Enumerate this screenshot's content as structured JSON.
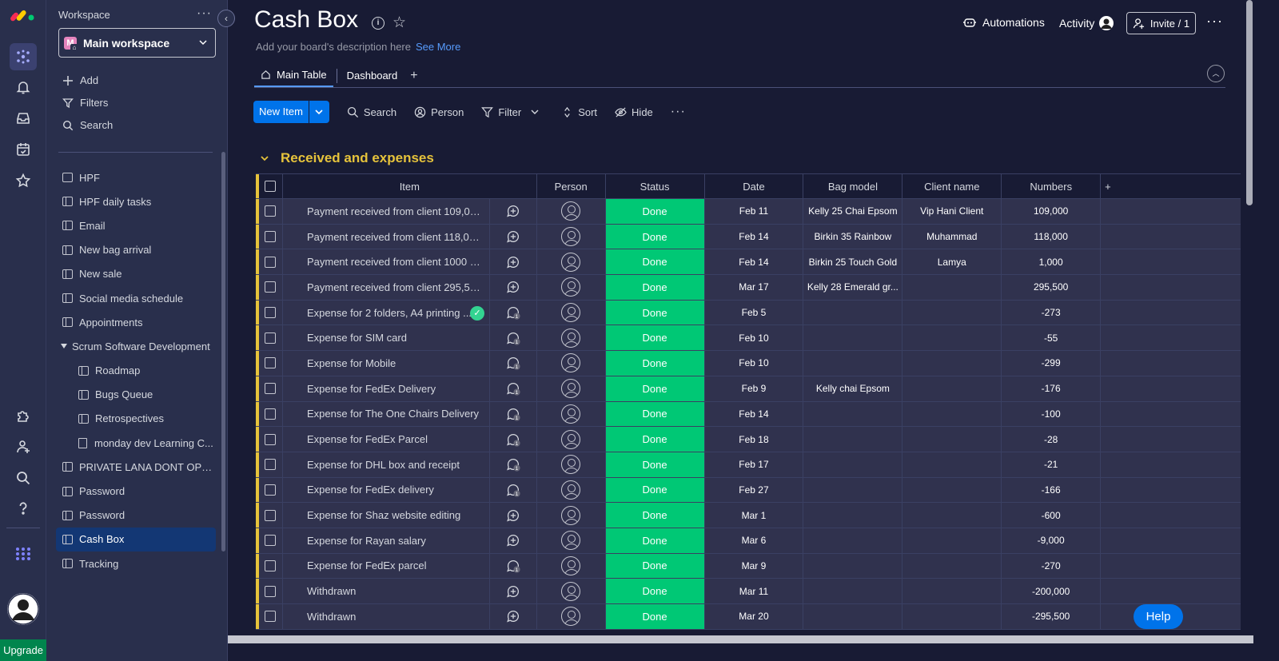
{
  "rail": {
    "items": [
      "home-icon",
      "notifications-icon",
      "inbox-icon",
      "my-work-icon",
      "favorites-icon",
      "apps-icon",
      "invite-members-icon",
      "search-icon",
      "help-icon",
      "product-switcher-icon"
    ],
    "upgrade_label": "Upgrade"
  },
  "sidebar": {
    "workspace_label": "Workspace",
    "workspace_badge": "M",
    "workspace_name": "Main workspace",
    "actions": {
      "add": "Add",
      "filters": "Filters",
      "search": "Search"
    },
    "items": [
      {
        "label": "HPF",
        "type": "dashboard"
      },
      {
        "label": "HPF daily tasks",
        "type": "board"
      },
      {
        "label": "Email",
        "type": "board"
      },
      {
        "label": "New bag arrival",
        "type": "board"
      },
      {
        "label": "New sale",
        "type": "board"
      },
      {
        "label": "Social media schedule",
        "type": "board"
      },
      {
        "label": "Appointments",
        "type": "board"
      },
      {
        "label": "Scrum Software Development",
        "type": "folder"
      },
      {
        "label": "Roadmap",
        "type": "sub-board"
      },
      {
        "label": "Bugs Queue",
        "type": "sub-board"
      },
      {
        "label": "Retrospectives",
        "type": "sub-board"
      },
      {
        "label": "monday dev Learning C...",
        "type": "sub-doc"
      },
      {
        "label": "PRIVATE LANA DONT OPEN",
        "type": "board"
      },
      {
        "label": "Password",
        "type": "board"
      },
      {
        "label": "Password",
        "type": "board"
      },
      {
        "label": "Cash Box",
        "type": "board",
        "active": true
      },
      {
        "label": "Tracking",
        "type": "board"
      }
    ]
  },
  "board": {
    "title": "Cash Box",
    "description": "Add your board's description here",
    "see_more": "See More",
    "automations_label": "Automations",
    "activity_label": "Activity",
    "invite_label": "Invite / 1",
    "tabs": [
      {
        "label": "Main Table",
        "active": true
      },
      {
        "label": "Dashboard",
        "active": false
      }
    ],
    "toolbar": {
      "new_item": "New Item",
      "search": "Search",
      "person": "Person",
      "filter": "Filter",
      "sort": "Sort",
      "hide": "Hide"
    },
    "group": {
      "title": "Received and expenses",
      "color": "#e6c33b"
    },
    "columns": [
      "Item",
      "Person",
      "Status",
      "Date",
      "Bag model",
      "Client name",
      "Numbers"
    ],
    "status_color": "#00c875",
    "rows": [
      {
        "item": "Payment received from client 109,000...",
        "updates": false,
        "status": "Done",
        "date": "Feb 11",
        "bag": "Kelly 25 Chai Epsom",
        "client": "Vip Hani Client",
        "number": "109,000"
      },
      {
        "item": "Payment received from client 118,000...",
        "updates": false,
        "status": "Done",
        "date": "Feb 14",
        "bag": "Birkin 35 Rainbow",
        "client": "Muhammad",
        "number": "118,000"
      },
      {
        "item": "Payment received from client 1000 Di...",
        "updates": false,
        "status": "Done",
        "date": "Feb 14",
        "bag": "Birkin 25 Touch Gold",
        "client": "Lamya",
        "number": "1,000"
      },
      {
        "item": "Payment received from client 295,50...",
        "updates": false,
        "status": "Done",
        "date": "Mar 17",
        "bag": "Kelly 28 Emerald gr...",
        "client": "",
        "number": "295,500"
      },
      {
        "item": "Expense for 2 folders, A4 printing ...",
        "updates": true,
        "check": true,
        "status": "Done",
        "date": "Feb 5",
        "bag": "",
        "client": "",
        "number": "-273"
      },
      {
        "item": "Expense for SIM card",
        "updates": true,
        "status": "Done",
        "date": "Feb 10",
        "bag": "",
        "client": "",
        "number": "-55"
      },
      {
        "item": "Expense for Mobile",
        "updates": true,
        "status": "Done",
        "date": "Feb 10",
        "bag": "",
        "client": "",
        "number": "-299"
      },
      {
        "item": "Expense for FedEx Delivery",
        "updates": true,
        "status": "Done",
        "date": "Feb 9",
        "bag": "Kelly chai Epsom",
        "client": "",
        "number": "-176"
      },
      {
        "item": "Expense for The One Chairs Delivery",
        "updates": true,
        "status": "Done",
        "date": "Feb 14",
        "bag": "",
        "client": "",
        "number": "-100"
      },
      {
        "item": "Expense for FedEx Parcel",
        "updates": true,
        "status": "Done",
        "date": "Feb 18",
        "bag": "",
        "client": "",
        "number": "-28"
      },
      {
        "item": "Expense for DHL box and receipt",
        "updates": true,
        "status": "Done",
        "date": "Feb 17",
        "bag": "",
        "client": "",
        "number": "-21"
      },
      {
        "item": "Expense for FedEx delivery",
        "updates": true,
        "status": "Done",
        "date": "Feb 27",
        "bag": "",
        "client": "",
        "number": "-166"
      },
      {
        "item": "Expense for Shaz website editing",
        "updates": false,
        "status": "Done",
        "date": "Mar 1",
        "bag": "",
        "client": "",
        "number": "-600"
      },
      {
        "item": "Expense for Rayan salary",
        "updates": false,
        "status": "Done",
        "date": "Mar 6",
        "bag": "",
        "client": "",
        "number": "-9,000"
      },
      {
        "item": "Expense for FedEx parcel",
        "updates": true,
        "status": "Done",
        "date": "Mar 9",
        "bag": "",
        "client": "",
        "number": "-270"
      },
      {
        "item": "Withdrawn",
        "updates": false,
        "status": "Done",
        "date": "Mar 11",
        "bag": "",
        "client": "",
        "number": "-200,000"
      },
      {
        "item": "Withdrawn",
        "updates": false,
        "status": "Done",
        "date": "Mar 20",
        "bag": "",
        "client": "",
        "number": "-295,500"
      }
    ]
  },
  "help_label": "Help"
}
